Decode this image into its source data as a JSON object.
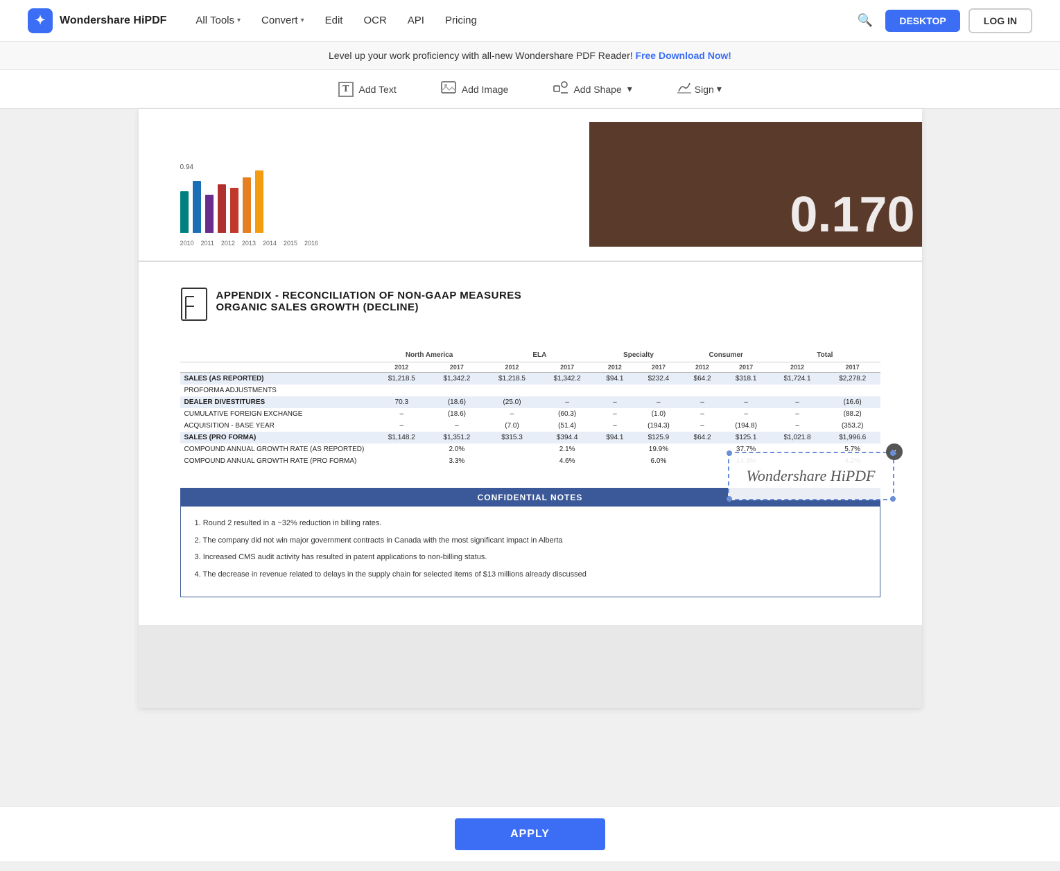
{
  "app": {
    "name": "Wondershare HiPDF",
    "logo_char": "✦"
  },
  "navbar": {
    "logo_text": "Wondershare HiPDF",
    "links": [
      {
        "label": "All Tools",
        "has_dropdown": true
      },
      {
        "label": "Convert",
        "has_dropdown": true
      },
      {
        "label": "Edit",
        "has_dropdown": false
      },
      {
        "label": "OCR",
        "has_dropdown": false
      },
      {
        "label": "API",
        "has_dropdown": false
      },
      {
        "label": "Pricing",
        "has_dropdown": false
      }
    ],
    "btn_desktop": "DESKTOP",
    "btn_login": "LOG IN"
  },
  "toolbar": {
    "items": [
      {
        "id": "add-text",
        "label": "Add Text",
        "icon": "T"
      },
      {
        "id": "add-image",
        "label": "Add Image",
        "icon": "🖼"
      },
      {
        "id": "add-shape",
        "label": "Add Shape",
        "icon": "◇",
        "has_dropdown": true
      },
      {
        "id": "sign",
        "label": "Sign",
        "icon": "✍",
        "has_dropdown": true
      }
    ]
  },
  "promo": {
    "text": "Level up your work proficiency with all-new Wondershare PDF Reader!",
    "link_text": "Free Download Now!"
  },
  "chart": {
    "top_label": "0.94",
    "years": [
      "2010",
      "2011",
      "2012",
      "2013",
      "2014",
      "2015",
      "2016"
    ],
    "colors": [
      "#008080",
      "#1a6eb5",
      "#6a2d8f",
      "#b03030",
      "#c0392b",
      "#e67e22",
      "#f39c12"
    ],
    "right_number": "0.170"
  },
  "appendix": {
    "icon": "⊞",
    "title1": "APPENDIX - RECONCILIATION OF NON-GAAP MEASURES",
    "title2": "ORGANIC SALES GROWTH (DECLINE)"
  },
  "table": {
    "group_headers": [
      {
        "label": ""
      },
      {
        "label": "North America"
      },
      {
        "label": "ELA"
      },
      {
        "label": "Specialty"
      },
      {
        "label": "Consumer"
      },
      {
        "label": "Total"
      }
    ],
    "sub_headers": [
      "",
      "2012",
      "2017",
      "2012",
      "2017",
      "2012",
      "2017",
      "2012",
      "2017",
      "2012",
      "2017"
    ],
    "rows": [
      {
        "type": "highlighted",
        "label": "SALES (AS REPORTED)",
        "values": [
          "$1,218.5",
          "$1,342.2",
          "$1,218.5",
          "$1,342.2",
          "$94.1",
          "$232.4",
          "$64.2",
          "$318.1",
          "$1,724.1",
          "$2,278.2"
        ]
      },
      {
        "type": "plain",
        "label": "PROFORMA ADJUSTMENTS",
        "values": [
          "",
          "",
          "",
          "",
          "",
          "",
          "",
          "",
          "",
          ""
        ]
      },
      {
        "type": "highlighted",
        "label": "DEALER DIVESTITURES",
        "values": [
          "70.3",
          "(18.6)",
          "(25.0)",
          "–",
          "–",
          "–",
          "–",
          "–",
          "–",
          "(16.6)"
        ]
      },
      {
        "type": "plain",
        "label": "CUMULATIVE FOREIGN EXCHANGE",
        "values": [
          "–",
          "(18.6)",
          "–",
          "(60.3)",
          "–",
          "(1.0)",
          "–",
          "–",
          "–",
          "(88.2)"
        ]
      },
      {
        "type": "plain",
        "label": "ACQUISITION - BASE YEAR",
        "values": [
          "–",
          "–",
          "(7.0)",
          "(51.4)",
          "–",
          "(194.3)",
          "–",
          "(194.8)",
          "–",
          "(353.2)"
        ]
      },
      {
        "type": "highlighted",
        "label": "SALES (PRO FORMA)",
        "values": [
          "$1,148.2",
          "$1,351.2",
          "$315.3",
          "$394.4",
          "$94.1",
          "$125.9",
          "$64.2",
          "$125.1",
          "$1,021.8",
          "$1,996.6"
        ]
      },
      {
        "type": "plain",
        "label": "COMPOUND ANNUAL GROWTH RATE (AS REPORTED)",
        "values": [
          "",
          "2.0%",
          "",
          "2.1%",
          "",
          "19.9%",
          "",
          "37.7%",
          "",
          "5.7%"
        ]
      },
      {
        "type": "plain",
        "label": "COMPOUND ANNUAL GROWTH RATE (PRO FORMA)",
        "values": [
          "",
          "3.3%",
          "",
          "4.6%",
          "",
          "6.0%",
          "",
          "14.3%",
          "",
          "4.2%"
        ]
      }
    ]
  },
  "confidential_notes": {
    "header": "CONFIDENTIAL NOTES",
    "notes": [
      "1. Round 2 resulted in a ~32% reduction in billing rates.",
      "2. The company did not win major government contracts in Canada with the most significant impact in Alberta",
      "3. Increased CMS audit activity has resulted in patent applications to non-billing status.",
      "4. The decrease in revenue related to delays in the supply chain for selected items of $13 millions already discussed"
    ]
  },
  "watermark": {
    "text": "Wondershare HiPDF",
    "close_label": "×"
  },
  "apply_button": {
    "label": "APPLY"
  }
}
